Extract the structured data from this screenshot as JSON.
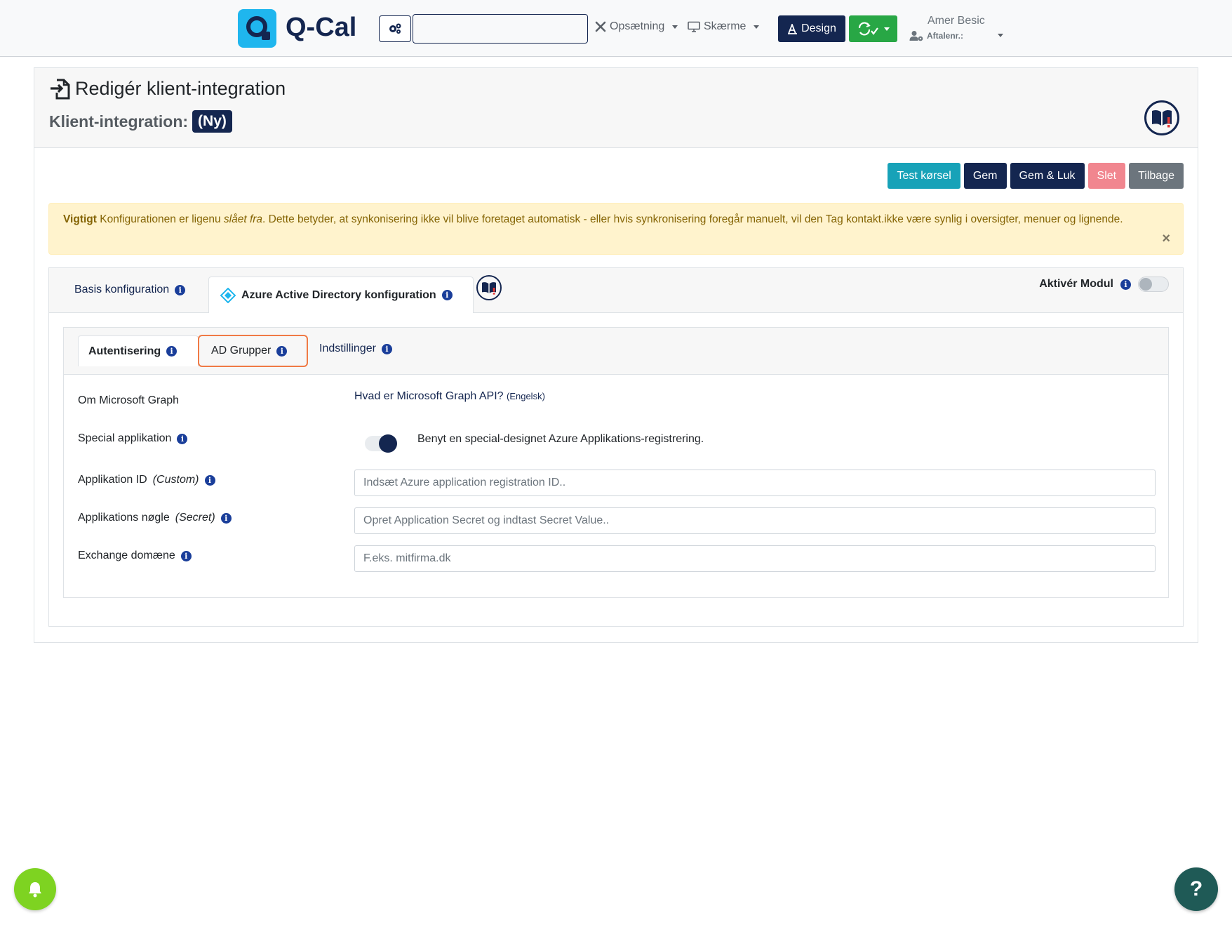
{
  "navbar": {
    "logo_text": "Q-Cal",
    "search_value": "",
    "setup_label": "Opsætning",
    "screens_label": "Skærme",
    "design_label": "Design",
    "user_name": "Amer Besic",
    "user_sub": "Aftalenr.:"
  },
  "page": {
    "title": "Redigér klient-integration",
    "subtitle": "Klient-integration:",
    "badge": "(Ny)"
  },
  "actions": {
    "test_label": "Test kørsel",
    "save_label": "Gem",
    "save_close_label": "Gem & Luk",
    "delete_label": "Slet",
    "back_label": "Tilbage"
  },
  "alert": {
    "strong": "Vigtigt",
    "text_1": " Konfigurationen er ligenu ",
    "emphasis": "slået fra",
    "text_2": ". Dette betyder, at synkonisering ikke vil blive foretaget automatisk - eller hvis synkronisering foregår manuelt, vil den Tag kontakt.ikke være synlig i oversigter, menuer og lignende.",
    "close": "×"
  },
  "config_tabs": {
    "basis": "Basis konfiguration",
    "azure": "Azure Active Directory konfiguration",
    "activate_label": "Aktivér Modul",
    "activate_on": false
  },
  "sub_tabs": {
    "auth": "Autentisering",
    "groups": "AD Grupper",
    "settings": "Indstillinger"
  },
  "form": {
    "graph_label": "Om Microsoft Graph",
    "graph_link": "Hvad er Microsoft Graph API?",
    "graph_link_small": "(Engelsk)",
    "special_label": "Special applikation",
    "special_text": "Benyt en special-designet Azure Applikations-registrering.",
    "special_on": true,
    "app_id_label": "Applikation ID",
    "app_id_suffix": "(Custom)",
    "app_id_placeholder": "Indsæt Azure application registration ID..",
    "app_key_label": "Applikations nøgle",
    "app_key_suffix": "(Secret)",
    "app_key_placeholder": "Opret Application Secret og indtast Secret Value..",
    "domain_label": "Exchange domæne",
    "domain_placeholder": "F.eks. mitfirma.dk"
  },
  "floating": {
    "help": "?"
  },
  "colors": {
    "navy": "#142650",
    "teal": "#17a2b8",
    "green": "#28a745",
    "danger_light": "#f1868f",
    "grey": "#6c757d",
    "highlight": "#f07a45",
    "warning_bg": "#fff3cd"
  }
}
